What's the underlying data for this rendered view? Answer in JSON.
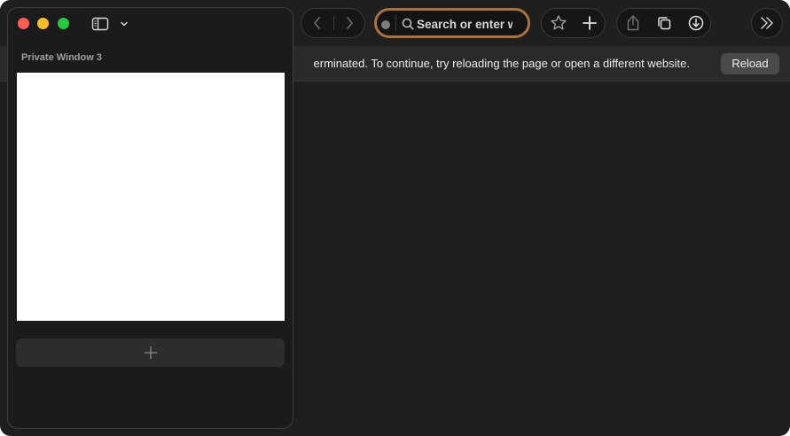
{
  "toolbar": {
    "address": {
      "placeholder": "Search or enter website name",
      "visible_text": "Search or enter w"
    }
  },
  "infobar": {
    "message": "erminated. To continue, try reloading the page or open a different website.",
    "reload_label": "Reload"
  },
  "sidebar": {
    "group_title": "Private Window 3"
  },
  "colors": {
    "close": "#ff5f57",
    "minimize": "#febc2e",
    "zoom": "#28c840",
    "address_focus_ring": "#a8733e"
  },
  "icons": {
    "sidebar_toggle": "sidebar-icon",
    "sidebar_menu": "chevron-down-icon",
    "back": "chevron-left-icon",
    "forward": "chevron-right-icon",
    "search": "magnifier-icon",
    "bookmark": "star-icon",
    "new_tab": "plus-icon",
    "share": "share-icon",
    "tab_overview": "tab-overview-icon",
    "downloads": "download-icon",
    "more": "chevrons-right-icon"
  }
}
